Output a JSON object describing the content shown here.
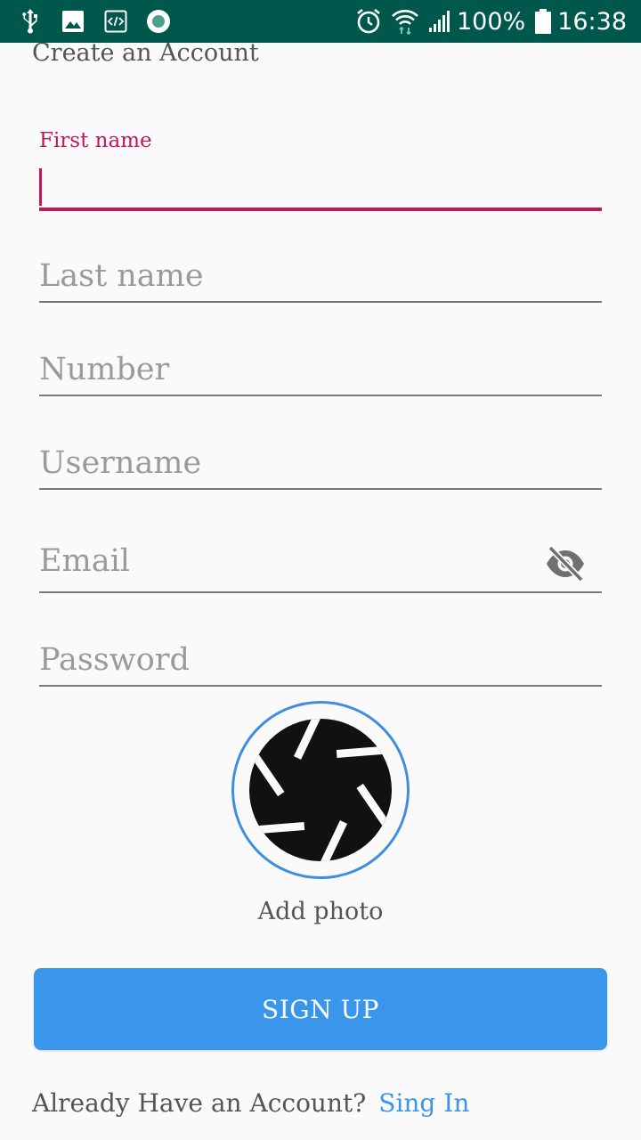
{
  "status_bar": {
    "battery_percent": "100%",
    "time": "16:38",
    "icons_left": [
      "usb-icon",
      "image-icon",
      "code-icon",
      "record-icon"
    ],
    "icons_right": [
      "alarm-icon",
      "wifi-icon",
      "signal-icon",
      "battery-icon"
    ]
  },
  "page": {
    "title": "Create an Account"
  },
  "form": {
    "first_name": {
      "label": "First name",
      "value": ""
    },
    "last_name": {
      "placeholder": "Last name"
    },
    "number": {
      "placeholder": "Number"
    },
    "username": {
      "placeholder": "Username"
    },
    "email": {
      "placeholder": "Email",
      "toggle_icon": "visibility-off-icon"
    },
    "password": {
      "placeholder": "Password"
    }
  },
  "photo": {
    "icon": "camera-aperture-icon",
    "label": "Add photo"
  },
  "actions": {
    "signup_label": "SIGN UP"
  },
  "footer": {
    "prompt": "Already Have an Account?",
    "link_label": "Sing In"
  },
  "colors": {
    "status_bar": "#00574b",
    "accent": "#c2185b",
    "primary": "#3a96ea",
    "background": "#fafafa"
  }
}
